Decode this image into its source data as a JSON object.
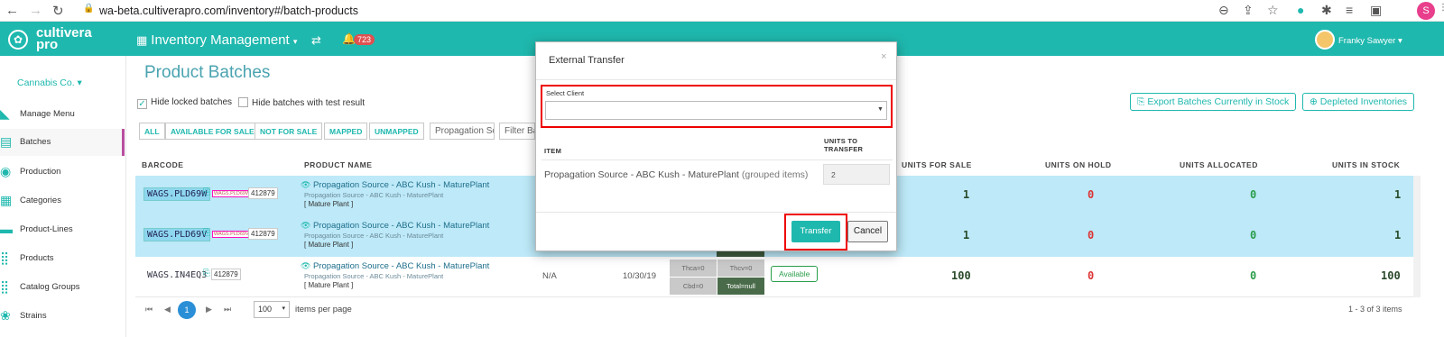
{
  "browser": {
    "url": "wa-beta.cultiverapro.com/inventory#/batch-products",
    "profile_initial": "S"
  },
  "header": {
    "logo_line1": "cultivera",
    "logo_line2": "pro",
    "module_title": "Inventory Management",
    "notification_count": "723",
    "user_name": "Franky Sawyer"
  },
  "sidebar": {
    "org": "Cannabis Co.",
    "items": [
      {
        "label": "Manage Menu",
        "icon": "menu-book-icon"
      },
      {
        "label": "Batches",
        "icon": "batches-icon"
      },
      {
        "label": "Production",
        "icon": "production-icon"
      },
      {
        "label": "Categories",
        "icon": "categories-icon"
      },
      {
        "label": "Product-Lines",
        "icon": "product-lines-icon"
      },
      {
        "label": "Products",
        "icon": "products-icon"
      },
      {
        "label": "Catalog Groups",
        "icon": "catalog-groups-icon"
      },
      {
        "label": "Strains",
        "icon": "strains-icon"
      }
    ]
  },
  "main": {
    "title": "Product Batches",
    "hide_locked": "Hide locked batches",
    "hide_test": "Hide batches with test result",
    "export_btn": "Export Batches Currently in Stock",
    "depleted_btn": "Depleted Inventories",
    "filters": [
      "ALL",
      "AVAILABLE FOR SALE",
      "NOT FOR SALE",
      "MAPPED",
      "UNMAPPED"
    ],
    "filter_product_placeholder": "Propagation Sc",
    "filter_batch_placeholder": "Filter Ba",
    "columns": {
      "barcode": "BARCODE",
      "product": "PRODUCT NAME",
      "for_sale": "UNITS FOR SALE",
      "on_hold": "UNITS ON HOLD",
      "allocated": "UNITS ALLOCATED",
      "in_stock": "UNITS IN STOCK"
    },
    "rows": [
      {
        "barcode": "WAGS.PLD69W",
        "num": "412879",
        "mini": "WAGS.PLD69W",
        "product": "Propagation Source - ABC Kush - MaturePlant",
        "sub": "Propagation Source - ABC Kush - MaturePlant",
        "type": "[ Mature Plant ]",
        "for_sale": "1",
        "on_hold": "0",
        "allocated": "0",
        "in_stock": "1"
      },
      {
        "barcode": "WAGS.PLD69V",
        "num": "412879",
        "mini": "WAGS.PLD69V",
        "product": "Propagation Source - ABC Kush - MaturePlant",
        "sub": "Propagation Source - ABC Kush - MaturePlant",
        "type": "[ Mature Plant ]",
        "for_sale": "1",
        "on_hold": "0",
        "allocated": "0",
        "in_stock": "1"
      },
      {
        "barcode": "WAGS.IN4EQ3",
        "num": "412879",
        "product": "Propagation Source - ABC Kush - MaturePlant",
        "sub": "Propagation Source - ABC Kush - MaturePlant",
        "type": "[ Mature Plant ]",
        "test": "N/A",
        "date": "10/30/19",
        "thca": "Thca=0",
        "thcv": "Thcv=0",
        "cbd": "Cbd=0",
        "total": "Total=null",
        "status": "Available",
        "for_sale": "100",
        "on_hold": "0",
        "allocated": "0",
        "in_stock": "100"
      }
    ]
  },
  "pager": {
    "first": "⏮",
    "prev": "◀",
    "current": "1",
    "next": "▶",
    "last": "⏭",
    "per_page": "100",
    "per_page_label": "items per page",
    "range": "1 - 3 of 3 items"
  },
  "modal": {
    "title": "External Transfer",
    "close": "×",
    "select_client_label": "Select Client",
    "col_item": "ITEM",
    "col_units_1": "UNITS TO",
    "col_units_2": "TRANSFER",
    "item_name": "Propagation Source - ABC Kush - MaturePlant",
    "item_group": "(grouped items)",
    "units_value": "2",
    "transfer_btn": "Transfer",
    "cancel_btn": "Cancel"
  },
  "colors": {
    "brand": "#1fb8ae",
    "highlight_frame": "#e00000",
    "selected_row": "#bde9f8"
  }
}
